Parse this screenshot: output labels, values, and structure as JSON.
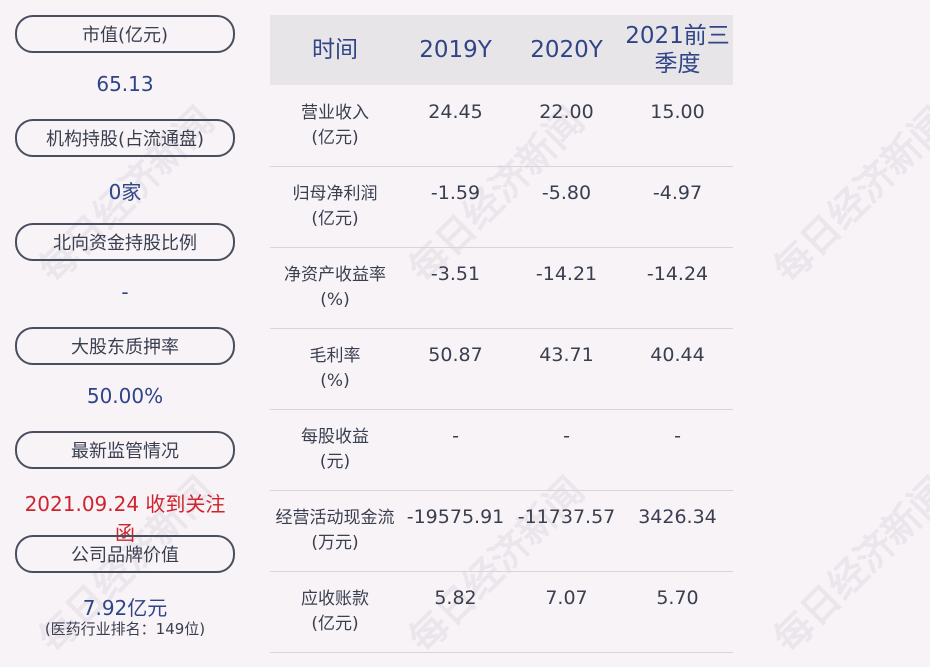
{
  "left_panel": [
    {
      "label": "市值(亿元)",
      "value": "65.13"
    },
    {
      "label": "机构持股(占流通盘)",
      "value": "0家"
    },
    {
      "label": "北向资金持股比例",
      "value": "-"
    },
    {
      "label": "大股东质押率",
      "value": "50.00%"
    },
    {
      "label": "最新监管情况",
      "value": "2021.09.24 收到关注函"
    },
    {
      "label": "公司品牌价值",
      "value": "7.92亿元",
      "sub": "(医药行业排名：149位)"
    }
  ],
  "table": {
    "headers": [
      "时间",
      "2019Y",
      "2020Y",
      "2021前三季度"
    ],
    "rows": [
      {
        "label": "营业收入\n(亿元)",
        "values": [
          "24.45",
          "22.00",
          "15.00"
        ]
      },
      {
        "label": "归母净利润\n(亿元)",
        "values": [
          "-1.59",
          "-5.80",
          "-4.97"
        ]
      },
      {
        "label": "净资产收益率\n(%)",
        "values": [
          "-3.51",
          "-14.21",
          "-14.24"
        ]
      },
      {
        "label": "毛利率\n(%)",
        "values": [
          "50.87",
          "43.71",
          "40.44"
        ]
      },
      {
        "label": "每股收益\n(元)",
        "values": [
          "-",
          "-",
          "-"
        ]
      },
      {
        "label": "经营活动现金流\n(万元)",
        "values": [
          "-19575.91",
          "-11737.57",
          "3426.34"
        ]
      },
      {
        "label": "应收账款\n(亿元)",
        "values": [
          "5.82",
          "7.07",
          "5.70"
        ]
      }
    ]
  },
  "watermark": "每日经济新闻"
}
